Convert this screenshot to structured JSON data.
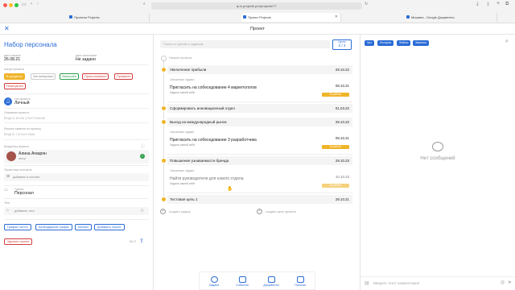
{
  "browser": {
    "url": "rc.projects.pro/projects/77",
    "tabs": [
      {
        "label": "Проекты Projects"
      },
      {
        "label": "Проект Projects"
      },
      {
        "label": "Мишаня - Google Документы"
      }
    ]
  },
  "header": {
    "title": "Проект"
  },
  "left": {
    "project_title": "Набор персонала",
    "start_label": "дата начала",
    "start_value": "26.08.21",
    "end_label": "дата окончания",
    "end_value": "Не задано",
    "status_label": "статус проекта",
    "statuses": [
      "В процессе",
      "Запланирован",
      "Завершён",
      "Приостановлен",
      "Провален",
      "Неактуален"
    ],
    "type_label": "тип проекта",
    "type_value": "Личный",
    "desc_label": "Описание проекта",
    "desc_placeholder": "Видно всем участникам",
    "personal_label": "Личные заметки по проекту",
    "personal_placeholder": "Видно только вам",
    "owner_label": "Владелец проекта",
    "owner_name": "Алина Агварян",
    "owner_role": "автор",
    "contacts_label": "Проектные контакты",
    "add_contact": "добавить в контакт",
    "group_label": "Группа",
    "group_value": "Персонал",
    "tags_label": "Теги",
    "add_tag": "добавить тэги",
    "view_buttons": [
      "График Гантта",
      "Календарный график",
      "Канбан",
      "Добавить хэштэг"
    ],
    "delete_button": "Удалить проект",
    "count_text": "50 Л"
  },
  "middle": {
    "search_placeholder": "Поиск по целям и задачам",
    "counter_label": "Цели",
    "counter_value": "3 / 3",
    "start_caption": "Начало проекта",
    "goals": [
      {
        "title": "Увеличение прибыли",
        "date": "29.10.22"
      },
      {
        "title": "Сформировать инновационный отдел",
        "date": "01.03.22"
      },
      {
        "title": "Выход на международный рынок",
        "date": "29.10.22"
      },
      {
        "title": "Повышение узнаваемости бренда",
        "date": "29.10.23"
      },
      {
        "title": "Тестовая цель 1",
        "date": "29.10.21"
      }
    ],
    "subs": [
      {
        "cap": "Связанные задачи",
        "title": "Пригласить на собеседование 4 маркетологов",
        "sub": "Задача самой себе",
        "date": "08.10.21",
        "badge": "В работе"
      },
      {
        "cap": "Связанные задачи",
        "title": "Пригласить на собеседование 3 разработчика",
        "sub": "Задача самой себе",
        "date": "09.10.21",
        "badge": "В работе"
      },
      {
        "cap": "Связанные задачи",
        "title": "Найти руководителя для нового отдела",
        "sub": "Задача самой себе",
        "date": "10.10.23",
        "badge": "В работе"
      }
    ],
    "add_task": "создать задачу",
    "add_goal": "создать цель проекта"
  },
  "right": {
    "tabs": [
      "Чат",
      "История",
      "Файлы",
      "Заметки"
    ],
    "empty_text": "Нет сообщений",
    "comment_placeholder": "Введите текст комментария"
  },
  "bottom_nav": [
    "Задачи",
    "События",
    "Документы",
    "Письма"
  ],
  "colors": {
    "accent": "#2b6cd6",
    "goal": "#f0b429",
    "danger": "#d23c3c"
  }
}
